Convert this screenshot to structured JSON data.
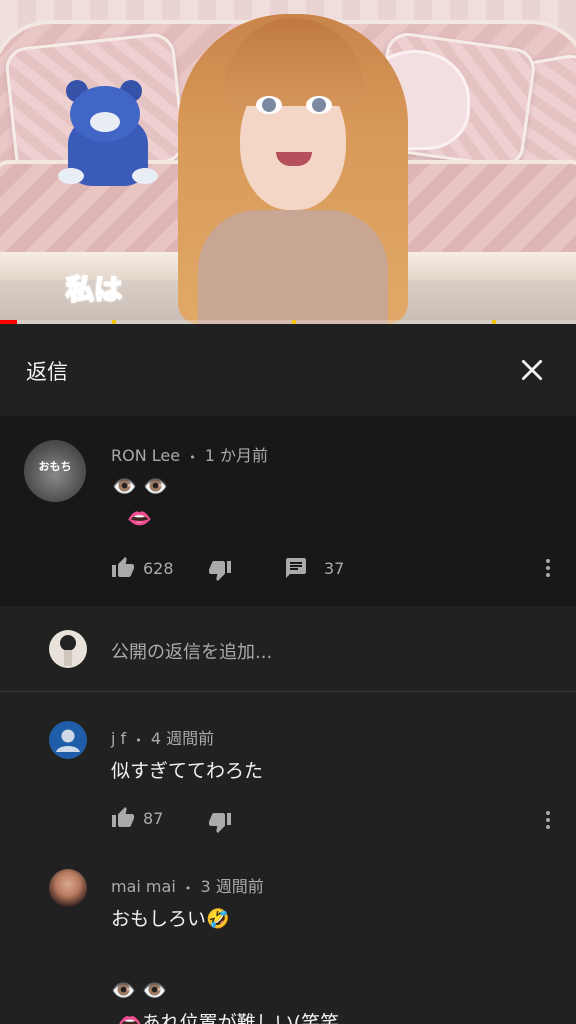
{
  "video": {
    "caption": "私は",
    "progress_fraction": 0.03
  },
  "panel": {
    "title": "返信"
  },
  "parent_comment": {
    "author": "RON Lee",
    "time": "1 か月前",
    "avatar_text": "おもち",
    "text_line1": "👁️ 👁️",
    "text_line2": "👄",
    "likes": "628",
    "replies": "37"
  },
  "add_reply": {
    "placeholder": "公開の返信を追加..."
  },
  "replies": [
    {
      "author": "j f",
      "time": "4 週間前",
      "text": "似すぎててわろた",
      "likes": "87"
    },
    {
      "author": "mai mai",
      "time": "3 週間前",
      "text_line1": "おもしろい🤣",
      "text_line2": "👁️ 👁️",
      "text_line3": "👄あれ位置が難しい(笑笑"
    }
  ],
  "separator": "•",
  "colors": {
    "panel_bg": "#212121",
    "parent_bg": "#181818",
    "text": "#f1f1f1",
    "meta": "#aaaaaa",
    "progress": "#ff0000"
  },
  "icons": [
    "close-icon",
    "like-icon",
    "dislike-icon",
    "reply-comment-icon",
    "more-vert-icon",
    "default-avatar-icon"
  ]
}
